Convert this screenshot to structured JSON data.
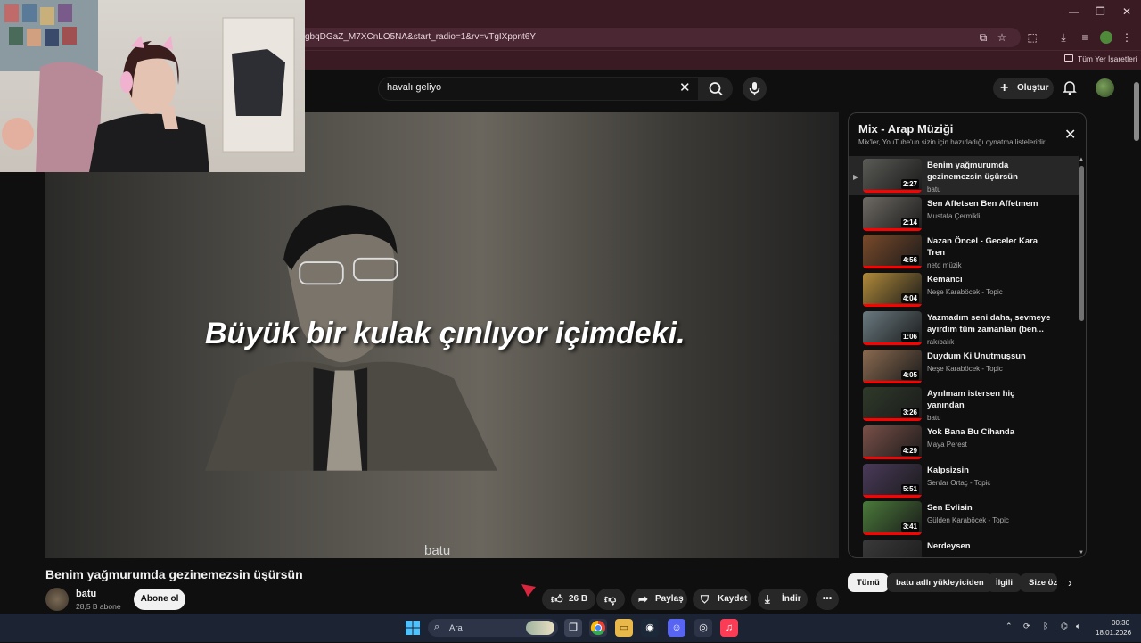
{
  "browser": {
    "url": "gbqDGaZ_M7XCnLO5NA&start_radio=1&rv=vTgIXppnt6Y",
    "bookmarks_folder": "Tüm Yer İşaretleri",
    "window_controls": {
      "minimize": "—",
      "maximize": "❐",
      "close": "✕"
    }
  },
  "youtube": {
    "search_value": "havalı geliyo",
    "create_label": "Oluştur"
  },
  "video": {
    "caption": "Büyük bir kulak çınlıyor içimdeki.",
    "watermark": "batu",
    "title": "Benim yağmurumda gezinemezsin üşürsün",
    "channel": "batu",
    "subscribers": "28,5 B abone",
    "subscribe_label": "Abone ol",
    "like_count": "26 B",
    "share_label": "Paylaş",
    "save_label": "Kaydet",
    "download_label": "İndir"
  },
  "playlist": {
    "title": "Mix - Arap Müziği",
    "subtitle": "Mix'ler, YouTube'un sizin için hazırladığı oynatma listeleridir",
    "items": [
      {
        "title": "Benim yağmurumda gezinemezsin üşürsün",
        "channel": "batu",
        "duration": "2:27",
        "progress": 1.0,
        "active": true,
        "thumb": "#5a5a56"
      },
      {
        "title": "Sen Affetsen Ben Affetmem",
        "channel": "Mustafa Çermikli",
        "duration": "2:14",
        "progress": 1.0,
        "active": false,
        "thumb": "#6e6a64"
      },
      {
        "title": "Nazan Öncel - Geceler Kara Tren",
        "channel": "netd müzik",
        "duration": "4:56",
        "progress": 1.0,
        "active": false,
        "thumb": "#7a4a2a"
      },
      {
        "title": "Kemancı",
        "channel": "Neşe Karaböcek - Topic",
        "duration": "4:04",
        "progress": 1.0,
        "active": false,
        "thumb": "#b08a3a"
      },
      {
        "title": "Yazmadım seni daha, sevmeye ayırdım tüm zamanları (ben...",
        "channel": "rakıbalık",
        "duration": "1:06",
        "progress": 1.0,
        "active": false,
        "thumb": "#6a7a80"
      },
      {
        "title": "Duydum Ki Unutmuşsun",
        "channel": "Neşe Karaböcek - Topic",
        "duration": "4:05",
        "progress": 1.0,
        "active": false,
        "thumb": "#8a6a50"
      },
      {
        "title": "Ayrılmam istersen hiç yanından",
        "channel": "batu",
        "duration": "3:26",
        "progress": 1.0,
        "active": false,
        "thumb": "#2f3a2a"
      },
      {
        "title": "Yok Bana Bu Cihanda",
        "channel": "Maya Perest",
        "duration": "4:29",
        "progress": 1.0,
        "active": false,
        "thumb": "#7a5048"
      },
      {
        "title": "Kalpsizsin",
        "channel": "Serdar Ortaç - Topic",
        "duration": "5:51",
        "progress": 1.0,
        "active": false,
        "thumb": "#4a3a5a"
      },
      {
        "title": "Sen Evlisin",
        "channel": "Gülden Karaböcek - Topic",
        "duration": "3:41",
        "progress": 1.0,
        "active": false,
        "thumb": "#4a7a3a"
      },
      {
        "title": "Nerdeysen",
        "channel": "",
        "duration": "",
        "progress": 0,
        "active": false,
        "thumb": "#3a3a3a"
      }
    ]
  },
  "chips": [
    {
      "label": "Tümü",
      "selected": true
    },
    {
      "label": "batu adlı yükleyiciden",
      "selected": false
    },
    {
      "label": "İlgili",
      "selected": false
    },
    {
      "label": "Size öz",
      "selected": false
    }
  ],
  "taskbar": {
    "search_label": "Ara",
    "time": "00:30",
    "date": "18.01.2026"
  },
  "colors": {
    "accent": "#ff0000",
    "browser_frame": "#3a1b24",
    "background": "#0f0f0f"
  }
}
